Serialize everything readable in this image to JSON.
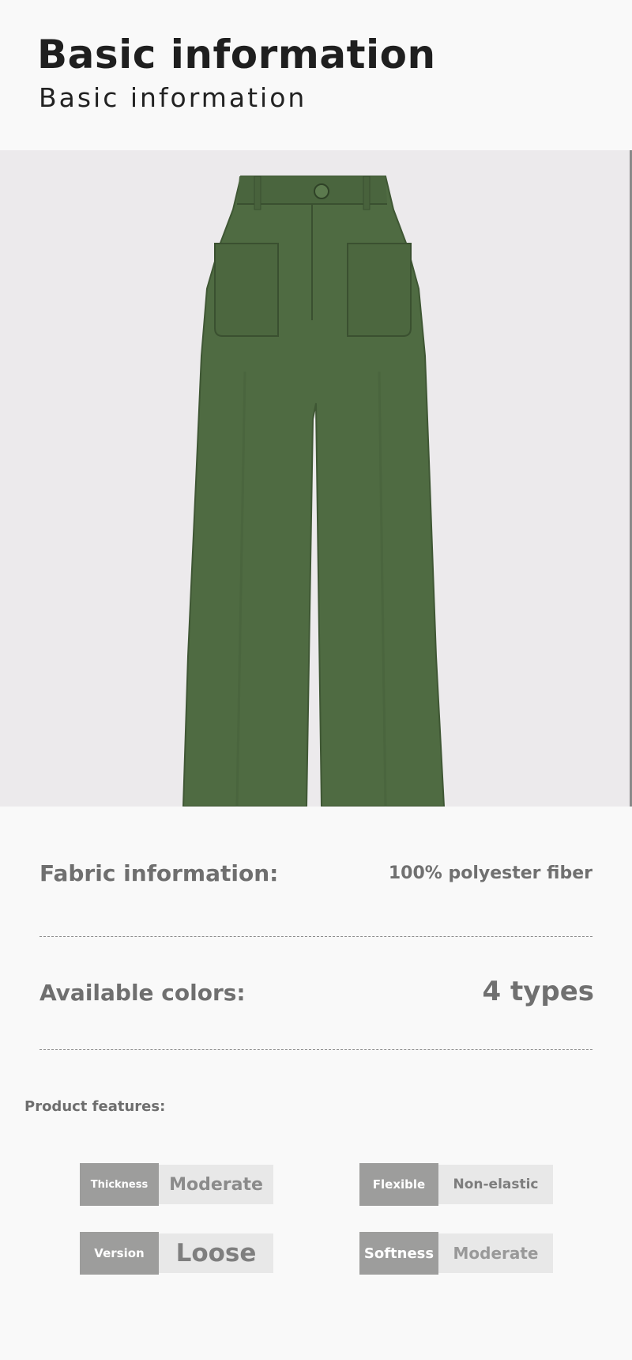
{
  "header": {
    "title": "Basic information",
    "subtitle": "Basic information"
  },
  "product_image": {
    "icon": "wide-leg-trousers-image",
    "garment_color": "#4f6b42",
    "background_color": "#eceaec"
  },
  "fabric": {
    "label": "Fabric information:",
    "value": "100% polyester fiber"
  },
  "colors": {
    "label": "Available colors:",
    "value": "4 types"
  },
  "features": {
    "heading": "Product features:",
    "items": [
      {
        "key": "Thickness",
        "value": "Moderate"
      },
      {
        "key": "Flexible",
        "value": "Non-elastic"
      },
      {
        "key": "Version",
        "value": "Loose"
      },
      {
        "key": "Softness",
        "value": "Moderate"
      }
    ]
  },
  "theme": {
    "key_bg": "#9d9d9c",
    "value_bg": "#e8e8e8",
    "text_gray": "#707070"
  }
}
